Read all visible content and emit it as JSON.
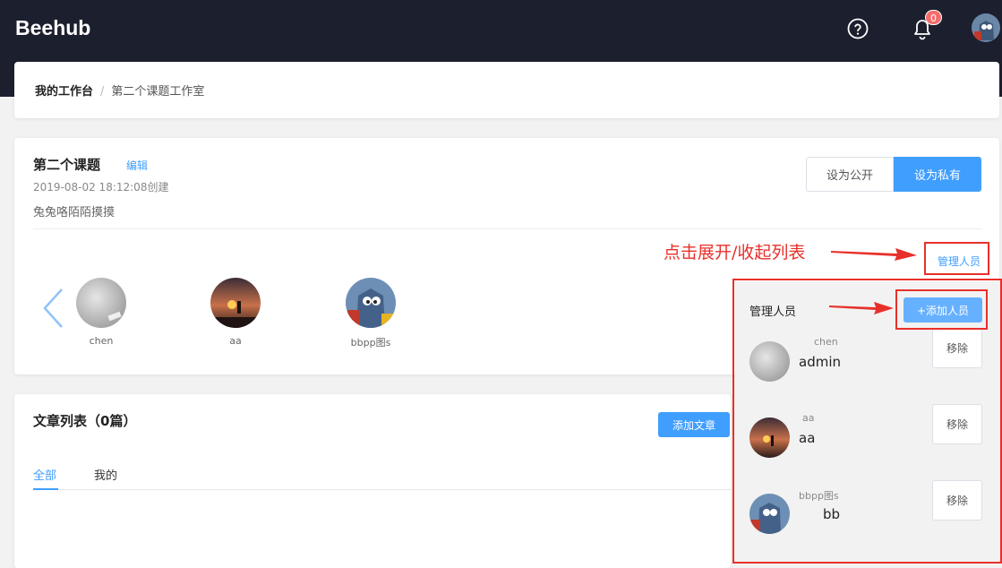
{
  "app": {
    "logo": "Beehub",
    "notification_count": "0"
  },
  "breadcrumb": {
    "home": "我的工作台",
    "separator": "/",
    "current": "第二个课题工作室"
  },
  "project": {
    "title": "第二个课题",
    "edit_label": "编辑",
    "created": "2019-08-02 18:12:08创建",
    "description": "兔兔咯陌陌摸摸",
    "btn_public": "设为公开",
    "btn_private": "设为私有",
    "manage_label": "管理人员"
  },
  "members": [
    {
      "name": "chen",
      "avatar": "gray-blur"
    },
    {
      "name": "aa",
      "avatar": "sunset"
    },
    {
      "name": "bbpp图s",
      "avatar": "cartoon-cat"
    }
  ],
  "annotations": {
    "expand_hint": "点击展开/收起列表"
  },
  "articles": {
    "title": "文章列表（0篇）",
    "add_button": "添加文章",
    "tabs": [
      "全部",
      "我的"
    ],
    "active_tab": "全部"
  },
  "manage_panel": {
    "title": "管理人员",
    "add_button": "+添加人员",
    "remove_label": "移除",
    "rows": [
      {
        "small": "chen",
        "big": "admin",
        "avatar": "gray-blur"
      },
      {
        "small": "aa",
        "big": "aa",
        "avatar": "sunset"
      },
      {
        "small": "bbpp图s",
        "big": "bb",
        "avatar": "cartoon-cat"
      }
    ]
  },
  "colors": {
    "topbar": "#1c1f2e",
    "accent": "#409eff",
    "annotation_red": "#e8302a",
    "badge": "#f56c6c"
  }
}
